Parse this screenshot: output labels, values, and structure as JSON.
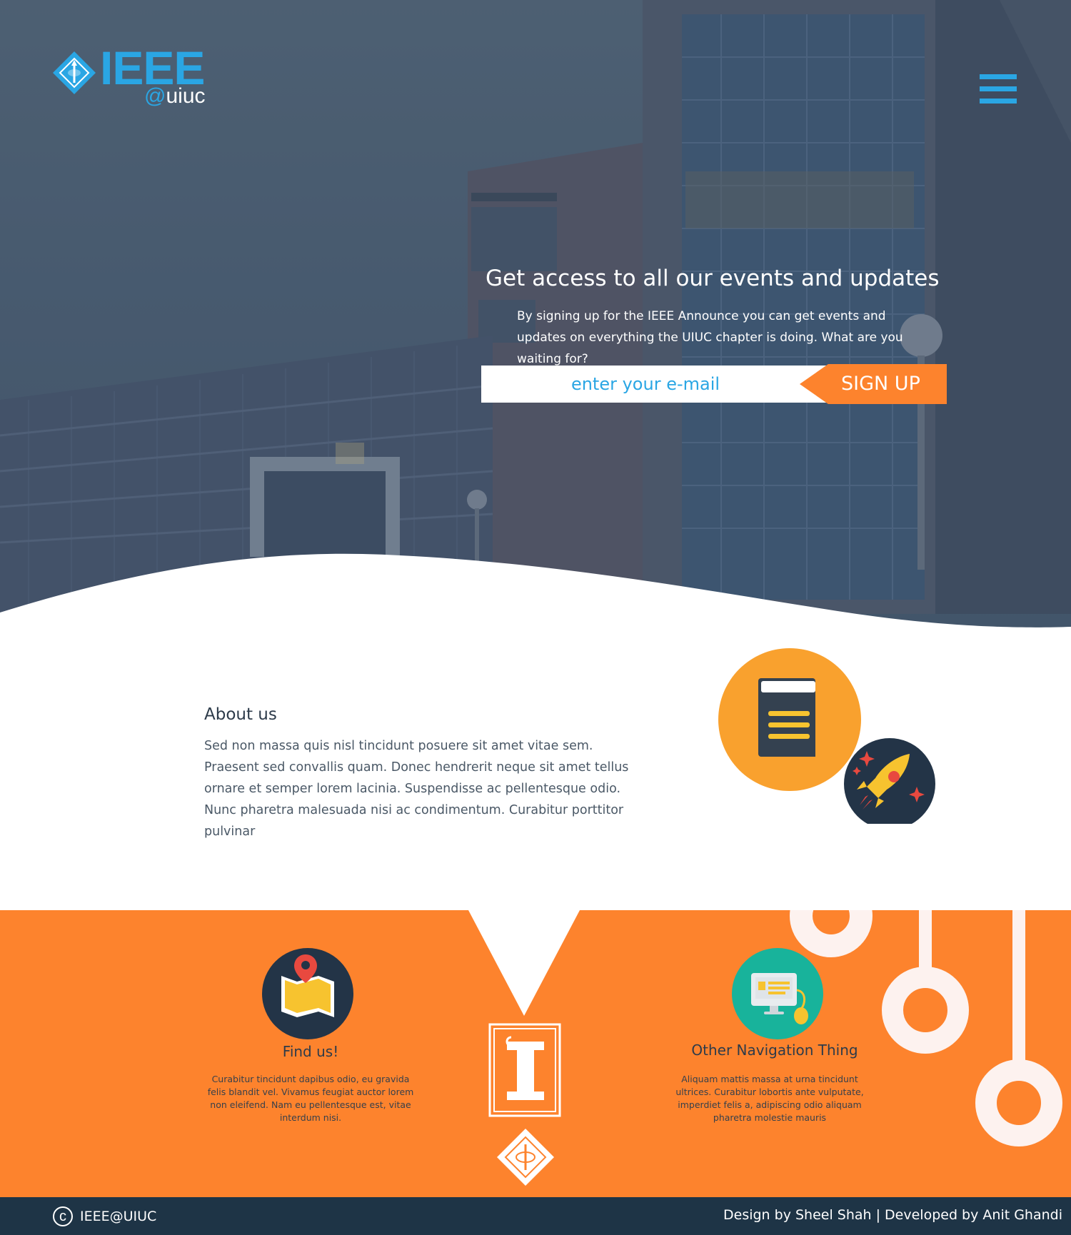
{
  "logo": {
    "name": "IEEE",
    "sub_at": "@",
    "sub_name": "uiuc"
  },
  "hero": {
    "heading": "Get access to all our events and updates",
    "text": "By signing up for the IEEE Announce you can get events and updates on everything the UIUC chapter is doing. What are you waiting for?",
    "email_placeholder": "enter your e-mail",
    "signup_label": "SIGN UP"
  },
  "about": {
    "heading": "About us",
    "text": "Sed non massa quis nisl tincidunt posuere sit amet vitae sem. Praesent sed convallis quam. Donec hendrerit neque sit amet tellus ornare et semper lorem lacinia. Suspendisse ac pellentesque odio. Nunc pharetra malesuada nisi ac condimentum. Curabitur porttitor pulvinar"
  },
  "nav": {
    "find": {
      "title": "Find us!",
      "text": "Curabitur tincidunt dapibus odio, eu gravida felis blandit vel. Vivamus feugiat auctor lorem non eleifend. Nam eu pellentesque est, vitae interdum nisi."
    },
    "other": {
      "title": "Other Navigation Thing",
      "text": "Aliquam mattis massa at urna tincidunt ultrices. Curabitur lobortis ante vulputate, imperdiet felis a, adipiscing odio aliquam pharetra molestie mauris"
    }
  },
  "footer": {
    "brand": "IEEE@UIUC",
    "credits": "Design by Sheel Shah | Developed by Anit Ghandi"
  },
  "colors": {
    "accent_blue": "#2aa6e4",
    "accent_orange": "#fd832d",
    "footer_navy": "#1e3446",
    "text_dark": "#2d3b4a"
  },
  "icons": [
    "ieee-diamond-icon",
    "menu-icon",
    "book-icon",
    "rocket-icon",
    "map-icon",
    "computer-icon",
    "illinois-logo-icon",
    "copyright-icon"
  ]
}
